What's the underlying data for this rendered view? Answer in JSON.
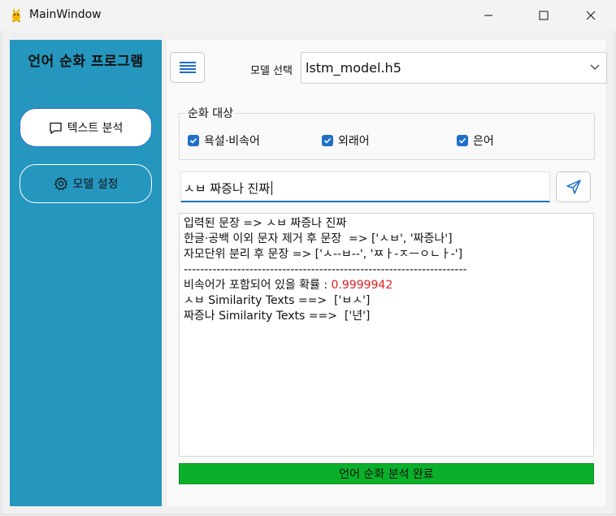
{
  "window": {
    "title": "MainWindow",
    "controls": {
      "minimize": "minimize",
      "maximize": "maximize",
      "close": "close"
    }
  },
  "sidebar": {
    "title": "언어 순화 프로그램",
    "buttons": [
      {
        "label": "텍스트 분석",
        "icon": "message-icon"
      },
      {
        "label": "모델 설정",
        "icon": "gear-icon"
      }
    ]
  },
  "toolbar": {
    "menu_icon": "menu-icon",
    "model_label": "모델 선택",
    "model_value": "lstm_model.h5"
  },
  "target": {
    "legend": "순화 대상",
    "options": [
      {
        "label": "욕설·비속어",
        "checked": true
      },
      {
        "label": "외래어",
        "checked": true
      },
      {
        "label": "은어",
        "checked": true
      }
    ]
  },
  "input": {
    "value": "ㅅㅂ 짜증나 진짜",
    "send_icon": "send-icon"
  },
  "output": {
    "lines": [
      "입력된 문장 => ㅅㅂ 짜증나 진짜",
      "한글·공백 이외 문자 제거 후 문장  => ['ㅅㅂ', '짜증나']",
      "자모단위 분리 후 문장 => ['ㅅ--ㅂ--', 'ㅉㅏ-ㅈㅡㅇㄴㅏ-']",
      "",
      "",
      "---------------------------------------------------------------------",
      "",
      "비속어가 포함되어 있을 확률 : ",
      "",
      "ㅅㅂ Similarity Texts ==>  ['ㅂㅅ']",
      "짜증나 Similarity Texts ==>  ['년']"
    ],
    "probability": "0.9999942"
  },
  "status": {
    "text": "언어 순화 분석 완료",
    "color": "#0bb02a"
  },
  "colors": {
    "sidebar": "#2596be",
    "accent": "#1f6fc9",
    "probability": "#e02020"
  }
}
